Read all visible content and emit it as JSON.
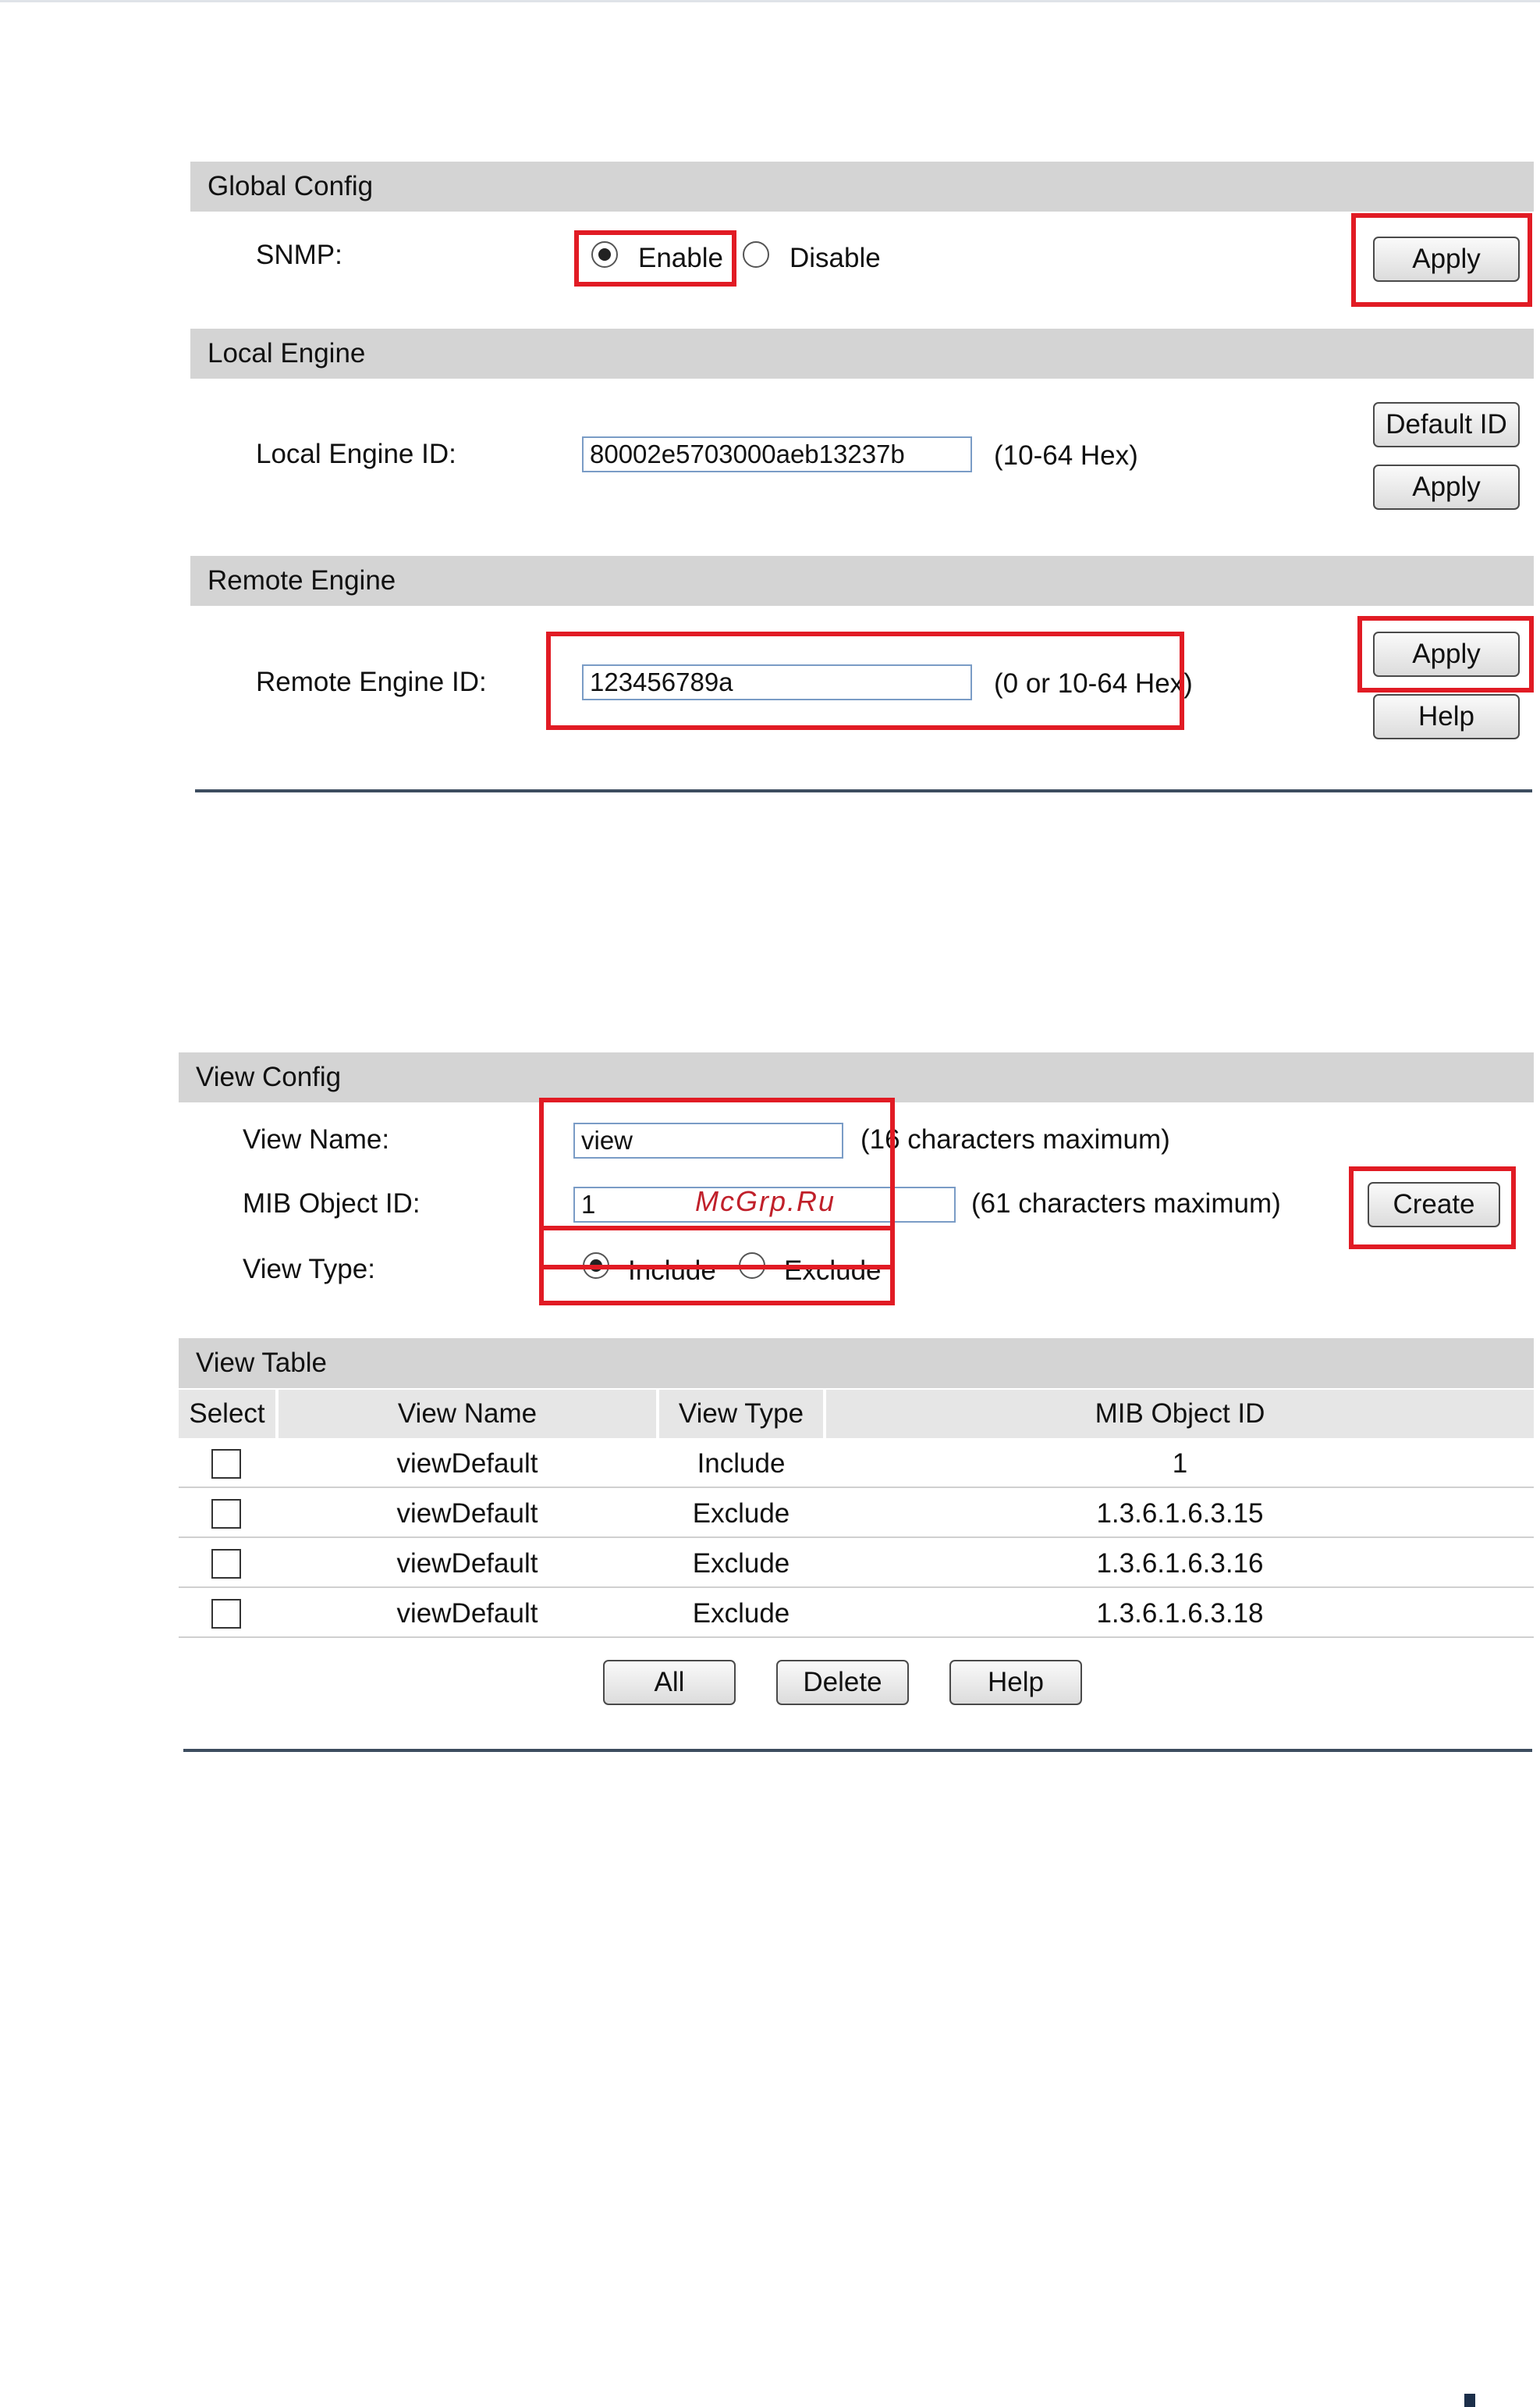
{
  "global_config": {
    "header": "Global Config",
    "snmp_label": "SNMP:",
    "enable_label": "Enable",
    "disable_label": "Disable",
    "selected": "Enable",
    "apply_label": "Apply"
  },
  "local_engine": {
    "header": "Local Engine",
    "id_label": "Local Engine ID:",
    "id_value": "80002e5703000aeb13237b",
    "hint": "(10-64 Hex)",
    "default_id_label": "Default ID",
    "apply_label": "Apply"
  },
  "remote_engine": {
    "header": "Remote Engine",
    "id_label": "Remote Engine ID:",
    "id_value": "123456789a",
    "hint": "(0 or 10-64 Hex)",
    "apply_label": "Apply",
    "help_label": "Help"
  },
  "view_config": {
    "header": "View Config",
    "view_name_label": "View Name:",
    "view_name_value": "view",
    "view_name_hint": "(16 characters maximum)",
    "mib_label": "MIB Object ID:",
    "mib_value": "1",
    "mib_hint": "(61 characters maximum)",
    "view_type_label": "View Type:",
    "include_label": "Include",
    "exclude_label": "Exclude",
    "selected": "Include",
    "create_label": "Create"
  },
  "view_table": {
    "header": "View Table",
    "columns": [
      "Select",
      "View Name",
      "View Type",
      "MIB Object ID"
    ],
    "rows": [
      {
        "view_name": "viewDefault",
        "view_type": "Include",
        "mib_object_id": "1"
      },
      {
        "view_name": "viewDefault",
        "view_type": "Exclude",
        "mib_object_id": "1.3.6.1.6.3.15"
      },
      {
        "view_name": "viewDefault",
        "view_type": "Exclude",
        "mib_object_id": "1.3.6.1.6.3.16"
      },
      {
        "view_name": "viewDefault",
        "view_type": "Exclude",
        "mib_object_id": "1.3.6.1.6.3.18"
      }
    ],
    "all_label": "All",
    "delete_label": "Delete",
    "help_label": "Help"
  },
  "watermark": "McGrp.Ru",
  "highlight_color": "#e11b24"
}
